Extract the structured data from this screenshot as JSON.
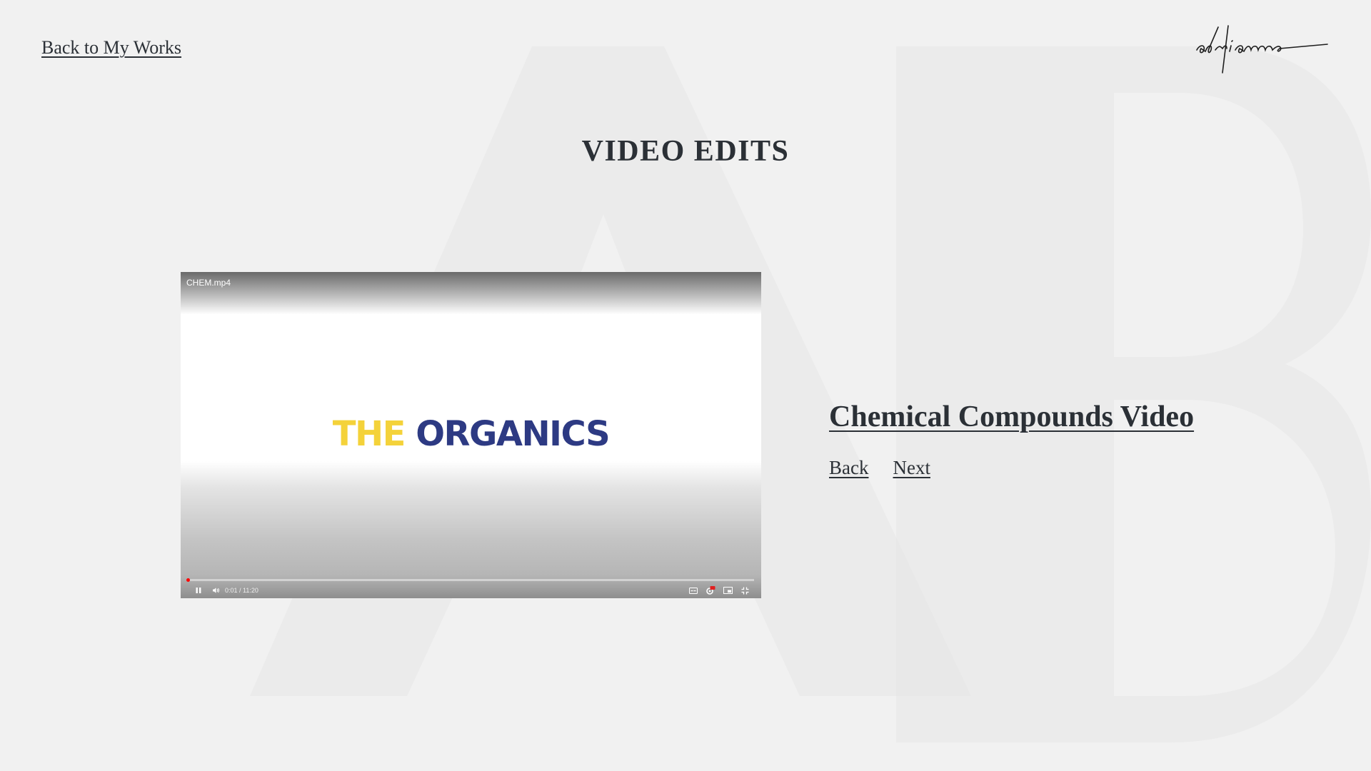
{
  "header": {
    "back_link": "Back to My Works",
    "logo_text": "adrianne"
  },
  "page_title": "VIDEO EDITS",
  "background_monogram": "AB",
  "player": {
    "file_name": "CHEM.mp4",
    "title_word_1": "THE",
    "title_word_2": "ORGANICS",
    "time_display": "0:01 / 11:20",
    "progress_fraction": 0.0015,
    "colors": {
      "title_yellow": "#f4d23a",
      "title_navy": "#2d3a83",
      "progress_red": "#ff0000"
    },
    "controls": [
      "pause-icon",
      "volume-icon",
      "captions-icon",
      "hd-settings-icon",
      "miniplayer-icon",
      "exit-fullscreen-icon"
    ]
  },
  "project": {
    "title": "Chemical Compounds Video",
    "back_label": "Back",
    "next_label": "Next"
  },
  "colors": {
    "background": "#f1f1f1",
    "text": "#2b3036"
  }
}
